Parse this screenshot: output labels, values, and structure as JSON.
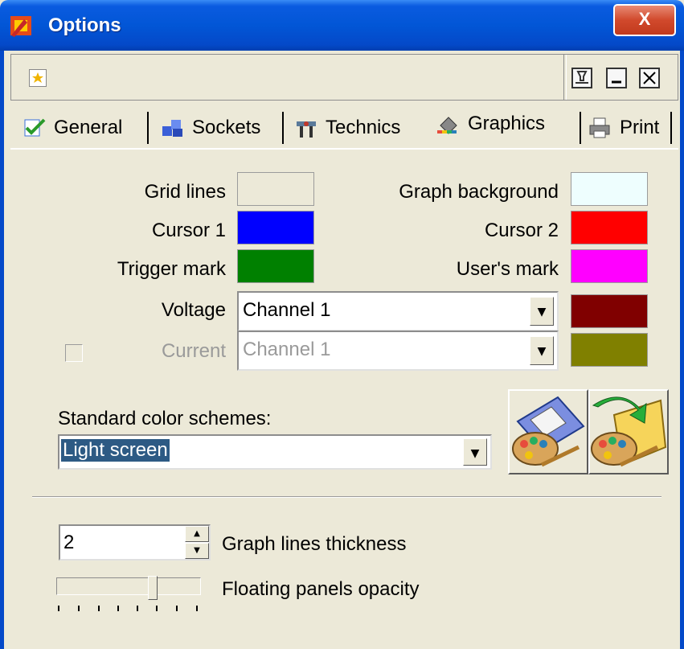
{
  "window": {
    "title": "Options",
    "close_label": "X"
  },
  "tabs": [
    {
      "label": "General",
      "icon": "check-icon"
    },
    {
      "label": "Sockets",
      "icon": "cubes-icon"
    },
    {
      "label": "Technics",
      "icon": "tools-icon"
    },
    {
      "label": "Graphics",
      "icon": "paint-icon",
      "active": true
    },
    {
      "label": "Print",
      "icon": "printer-icon"
    }
  ],
  "colors": {
    "grid_lines": {
      "label": "Grid lines",
      "color": "#ece9d8"
    },
    "graph_background": {
      "label": "Graph background",
      "color": "#eefefe"
    },
    "cursor1": {
      "label": "Cursor 1",
      "color": "#0000ff"
    },
    "cursor2": {
      "label": "Cursor 2",
      "color": "#ff0000"
    },
    "trigger_mark": {
      "label": "Trigger mark",
      "color": "#008000"
    },
    "users_mark": {
      "label": "User's mark",
      "color": "#ff00ff"
    },
    "voltage": {
      "label": "Voltage",
      "selected": "Channel 1",
      "color": "#800000"
    },
    "current": {
      "label": "Current",
      "selected": "Channel 1",
      "color": "#808000",
      "enabled": false,
      "checked": false
    }
  },
  "schemes": {
    "label": "Standard color schemes:",
    "selected": "Light screen"
  },
  "graph_lines": {
    "value": "2",
    "label": "Graph lines thickness"
  },
  "opacity": {
    "label": "Floating panels opacity",
    "level": 0.64
  }
}
